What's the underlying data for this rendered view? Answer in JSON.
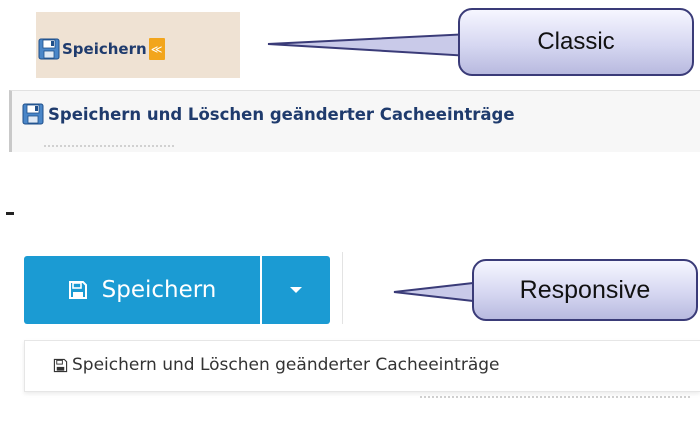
{
  "classic": {
    "save_label": "Speichern",
    "menu_item_label": "Speichern und Löschen geänderter Cacheeinträge",
    "callout_label": "Classic"
  },
  "separator_text": "-",
  "responsive": {
    "save_label": "Speichern",
    "menu_item_label": "Speichern und Löschen geänderter Cacheeinträge",
    "callout_label": "Responsive"
  },
  "icons": {
    "classic_save": "floppy-disk-icon",
    "classic_dropdown": "double-chevron-down-icon",
    "responsive_save": "floppy-disk-icon",
    "responsive_dropdown": "caret-down-icon"
  },
  "colors": {
    "classic_toolbar_bg": "#efe2d3",
    "classic_text": "#1f3b6d",
    "classic_chevron": "#f2a51c",
    "responsive_button": "#1b9bd3",
    "callout_border": "#3a3b78"
  }
}
